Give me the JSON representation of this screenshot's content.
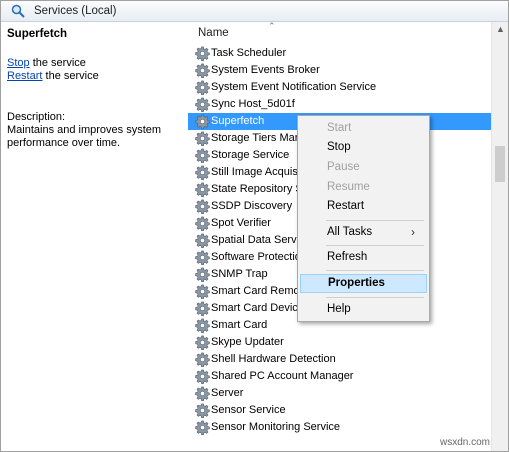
{
  "window": {
    "title": "Services (Local)"
  },
  "left_pane": {
    "service_name": "Superfetch",
    "actions": [
      {
        "link": "Stop",
        "suffix": " the service"
      },
      {
        "link": "Restart",
        "suffix": " the service"
      }
    ],
    "description_label": "Description:",
    "description_text": "Maintains and improves system performance over time."
  },
  "list": {
    "column_header": "Name",
    "rows": [
      "Task Scheduler",
      "System Events Broker",
      "System Event Notification Service",
      "Sync Host_5d01f",
      "Superfetch",
      "Storage Tiers Man",
      "Storage Service",
      "Still Image Acquis",
      "State Repository S",
      "SSDP Discovery",
      "Spot Verifier",
      "Spatial Data Servic",
      "Software Protectio",
      "SNMP Trap",
      "Smart Card Remo",
      "Smart Card Device",
      "Smart Card",
      "Skype Updater",
      "Shell Hardware Detection",
      "Shared PC Account Manager",
      "Server",
      "Sensor Service",
      "Sensor Monitoring Service"
    ],
    "selected_index": 4
  },
  "context_menu": {
    "start": "Start",
    "stop": "Stop",
    "pause": "Pause",
    "resume": "Resume",
    "restart": "Restart",
    "all_tasks": "All Tasks",
    "all_tasks_arrow": "›",
    "refresh": "Refresh",
    "properties": "Properties",
    "help": "Help"
  },
  "watermark": "wsxdn.com",
  "colors": {
    "selection": "#3399ff",
    "menu_highlight": "#cde8ff",
    "link": "#0645ad"
  }
}
